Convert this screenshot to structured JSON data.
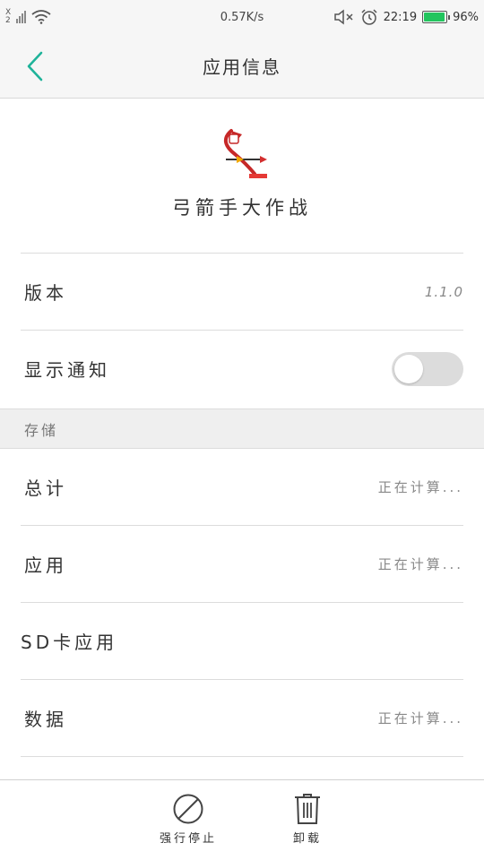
{
  "status_bar": {
    "sim_label_top": "X",
    "sim_label_bottom": "2",
    "network_speed": "0.57K/s",
    "time": "22:19",
    "battery_level": 0.96,
    "battery_text": "96%"
  },
  "nav": {
    "title": "应用信息"
  },
  "app": {
    "name": "弓箭手大作战"
  },
  "rows": {
    "version": {
      "label": "版本",
      "value": "1.1.0"
    },
    "notification": {
      "label": "显示通知",
      "enabled": false
    }
  },
  "storage": {
    "section_title": "存储",
    "items": [
      {
        "label": "总计",
        "value": "正在计算..."
      },
      {
        "label": "应用",
        "value": "正在计算..."
      },
      {
        "label": "SD卡应用",
        "value": ""
      },
      {
        "label": "数据",
        "value": "正在计算..."
      }
    ]
  },
  "bottom": {
    "force_stop_label": "强行停止",
    "uninstall_label": "卸载"
  },
  "colors": {
    "accent": "#1fb39a",
    "battery": "#22c55e"
  }
}
